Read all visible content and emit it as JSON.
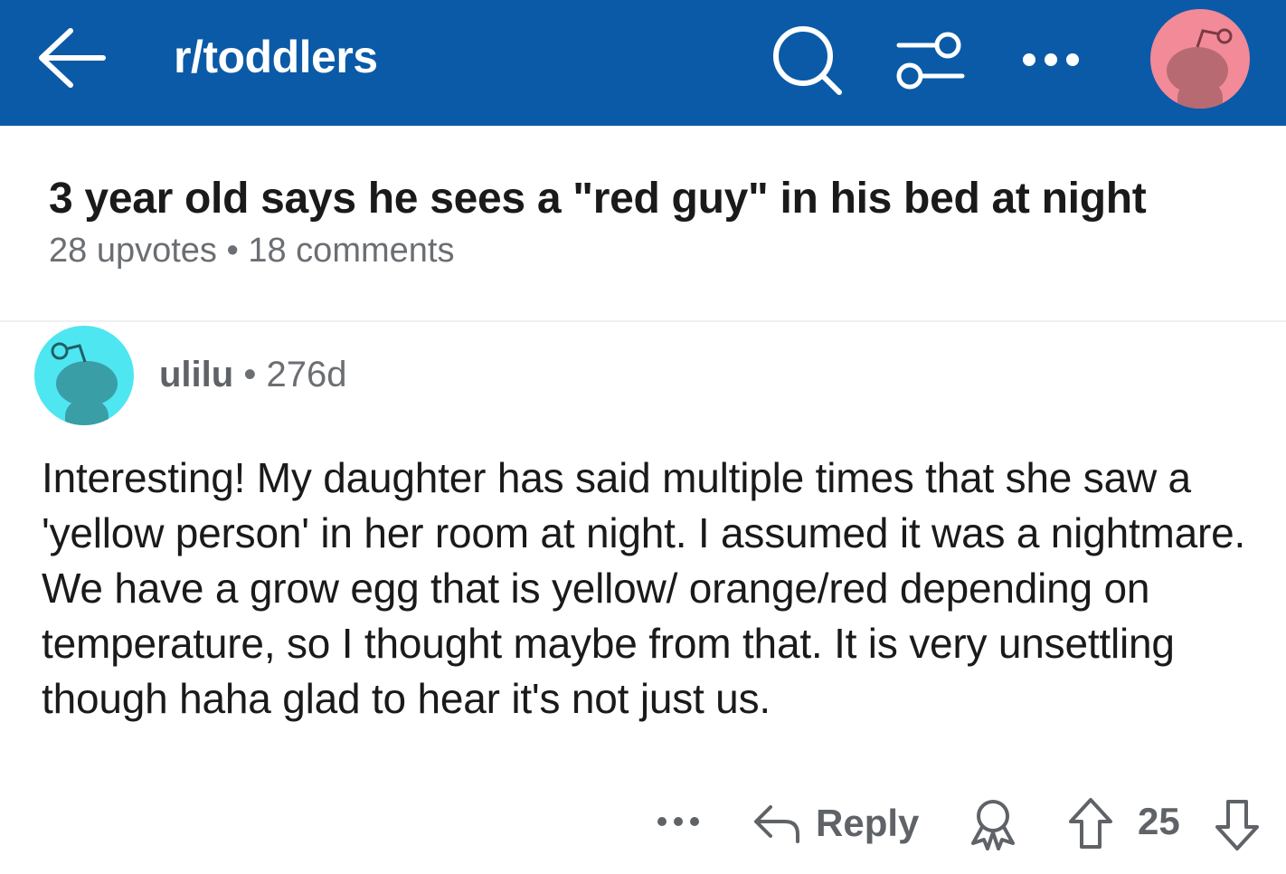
{
  "header": {
    "subreddit": "r/toddlers",
    "icons": [
      "back-arrow-icon",
      "search-icon",
      "filter-icon",
      "more-icon",
      "user-avatar"
    ],
    "colors": {
      "bar": "#0b5aa7",
      "user_avatar": "#f28a98"
    }
  },
  "post": {
    "title": "3 year old says he sees a \"red guy\" in his bed at night",
    "upvotes": "28 upvotes",
    "separator": "•",
    "comments": "18 comments"
  },
  "comment": {
    "author": "ulilu",
    "separator": "•",
    "age": "276d",
    "avatar_color": "#4ee6f1",
    "body": "Interesting! My daughter has said multiple times that she saw a 'yellow person' in her room at night. I assumed it was a nightmare. We have a grow egg that is yellow/ orange/red depending on temperature, so I thought maybe from that. It is very unsettling though haha glad to hear it's not just us."
  },
  "actions": {
    "reply_label": "Reply",
    "score": "25",
    "icons": [
      "more-icon",
      "reply-icon",
      "award-icon",
      "upvote-icon",
      "downvote-icon"
    ]
  }
}
